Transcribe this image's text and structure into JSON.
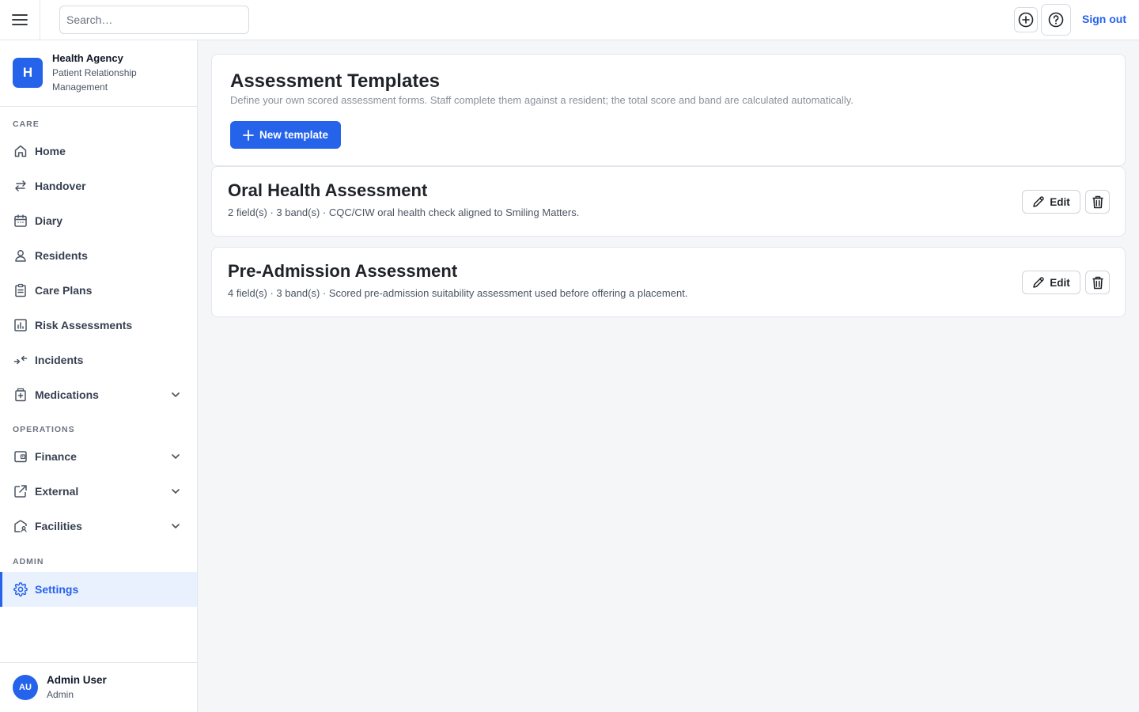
{
  "topbar": {
    "search_placeholder": "Search…",
    "sign_out_label": "Sign out"
  },
  "brand": {
    "logo_letter": "H",
    "name": "Health Agency",
    "subtitle": "Patient Relationship Management"
  },
  "sidebar": {
    "sections": {
      "care": "CARE",
      "operations": "OPERATIONS",
      "admin": "ADMIN"
    },
    "items": [
      {
        "label": "Home",
        "icon": "home-icon"
      },
      {
        "label": "Handover",
        "icon": "arrows-swap-icon"
      },
      {
        "label": "Diary",
        "icon": "calendar-icon"
      },
      {
        "label": "Residents",
        "icon": "user-icon"
      },
      {
        "label": "Care Plans",
        "icon": "clipboard-icon"
      },
      {
        "label": "Risk Assessments",
        "icon": "bar-chart-icon"
      },
      {
        "label": "Incidents",
        "icon": "arrows-converge-icon"
      },
      {
        "label": "Medications",
        "icon": "medical-kit-icon",
        "expandable": true
      },
      {
        "label": "Finance",
        "icon": "wallet-icon",
        "expandable": true
      },
      {
        "label": "External",
        "icon": "external-link-icon",
        "expandable": true
      },
      {
        "label": "Facilities",
        "icon": "building-user-icon",
        "expandable": true
      },
      {
        "label": "Settings",
        "icon": "gear-icon",
        "active": true
      }
    ]
  },
  "user": {
    "initials": "AU",
    "name": "Admin User",
    "role": "Admin"
  },
  "main": {
    "title": "Assessment Templates",
    "description": "Define your own scored assessment forms. Staff complete them against a resident; the total score and band are calculated automatically.",
    "new_button_label": "New template",
    "templates": [
      {
        "title": "Oral Health Assessment",
        "meta": "2 field(s) · 3 band(s) · CQC/CIW oral health check aligned to Smiling Matters.",
        "edit_label": "Edit"
      },
      {
        "title": "Pre-Admission Assessment",
        "meta": "4 field(s) · 3 band(s) · Scored pre-admission suitability assessment used before offering a placement.",
        "edit_label": "Edit"
      }
    ]
  },
  "colors": {
    "accent": "#2563eb",
    "active_bg": "#eaf1fe"
  }
}
